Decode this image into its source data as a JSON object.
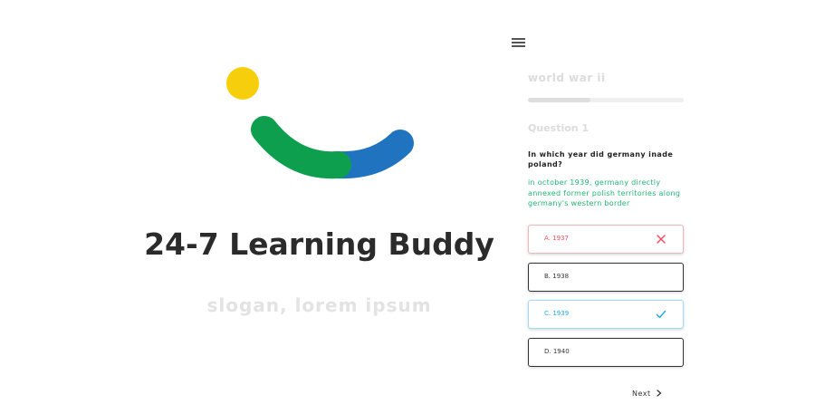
{
  "brand": {
    "title": "24-7 Learning Buddy",
    "slogan": "slogan, lorem ipsum",
    "logo_colors": {
      "dot": "#f6ce0b",
      "green": "#0e9f4e",
      "blue": "#1f73bf"
    }
  },
  "quiz": {
    "topic": "world war ii",
    "progress": 0.4,
    "question_number": "Question 1",
    "question": "In which year did germany inade poland?",
    "explanation": "in october 1939, germany directly annexed former polish territories along germany's western border",
    "options": [
      {
        "label": "A. 1937",
        "state": "wrong",
        "icon": "close-icon"
      },
      {
        "label": "B. 1938",
        "state": "neutral"
      },
      {
        "label": "C. 1939",
        "state": "correct",
        "icon": "check-icon"
      },
      {
        "label": "D. 1940",
        "state": "neutral"
      }
    ],
    "next_label": "Next",
    "colors": {
      "wrong": "#ee4b5a",
      "correct": "#1ea9e6",
      "explanation": "#22b573"
    }
  },
  "menu_icon": "hamburger-menu-icon"
}
